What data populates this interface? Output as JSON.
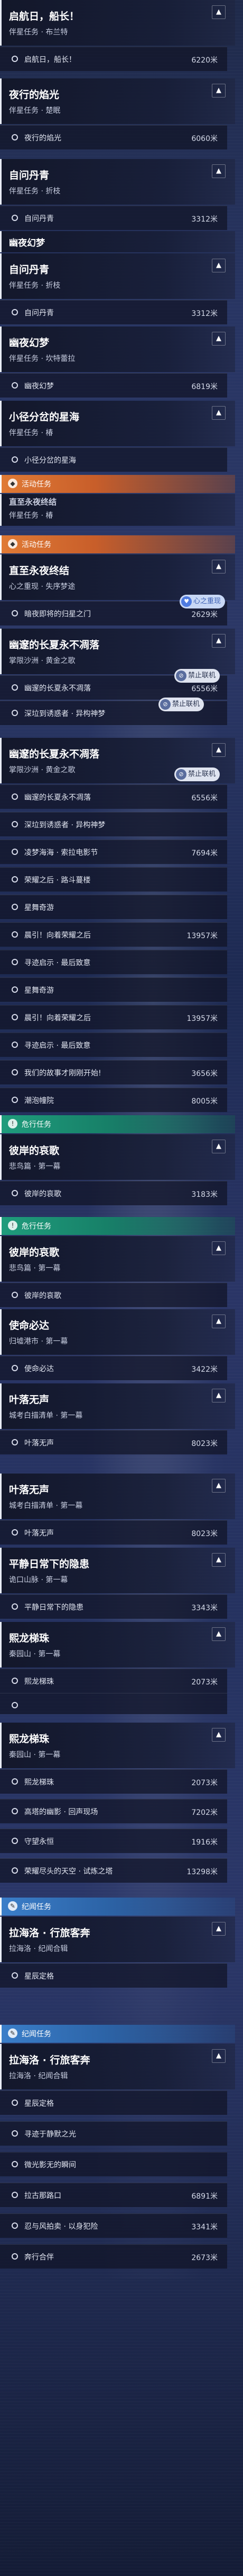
{
  "labels": {
    "activity": "活动任务",
    "dangerous": "危行任务",
    "record": "纪闻任务",
    "disconnect": "禁止联机",
    "heart": "心之重现"
  },
  "quests": {
    "q1": {
      "title": "启航日，船长！",
      "sub": "伴星任务 · 布兰特",
      "obj": "启航日，船长！",
      "dist": "6220米"
    },
    "q2": {
      "title": "夜行的焰光",
      "sub": "伴星任务 · 楚眠",
      "obj": "夜行的焰光",
      "dist": "6060米"
    },
    "q3": {
      "title": "自问丹青",
      "sub": "伴星任务 · 折枝",
      "obj": "自问丹青",
      "dist": "3312米"
    },
    "q4": {
      "title": "幽夜幻梦",
      "sub": "伴星任务 · 坎特蕾拉",
      "obj": "幽夜幻梦",
      "dist": "6819米"
    },
    "q5": {
      "title": "小径分岔的星海",
      "sub": "伴星任务 · 椿",
      "obj": "小径分岔的星海"
    },
    "q6": {
      "title": "直至永夜终结",
      "sub": "心之重现 · 失序梦途",
      "obj": "暗夜即将的归星之门",
      "dist": "2629米"
    },
    "q7": {
      "title": "幽邃的长夏永不凋落",
      "sub": "掌限沙洲 · 黄金之歌",
      "obj": "幽邃的长夏永不凋落",
      "dist": "6556米",
      "obj2": "深垃到诱惑者 · 异构神梦"
    },
    "q8": {
      "rows": [
        {
          "t": "幽邃的长夏永不凋落",
          "d": "6556米"
        },
        {
          "t": "深垃到诱惑者 · 异构神梦",
          "d": ""
        },
        {
          "t": "凌梦海海 · 索拉电影节",
          "d": "7694米"
        },
        {
          "t": "荣耀之后 · 路斗蔓楼",
          "d": ""
        },
        {
          "t": "星舞奇游",
          "d": ""
        },
        {
          "t": "晨引！向着荣耀之后",
          "d": "13957米"
        },
        {
          "t": "寻迹启示 · 最后致意",
          "d": ""
        },
        {
          "t": "星舞奇游",
          "d": ""
        },
        {
          "t": "晨引！向着荣耀之后",
          "d": "13957米"
        },
        {
          "t": "寻迹启示 · 最后致意",
          "d": ""
        },
        {
          "t": "我们的故事才刚刚开始!",
          "d": "3656米"
        },
        {
          "t": "潮泡幢院",
          "d": "8005米"
        }
      ]
    },
    "q9": {
      "title": "彼岸的哀歌",
      "sub": "悲鸟篇 · 第一幕",
      "obj": "彼岸的哀歌",
      "dist": "3183米"
    },
    "q10": {
      "title": "使命必达",
      "sub": "归墟港市 · 第一幕",
      "obj": "使命必达",
      "dist": "3422米"
    },
    "q11": {
      "title": "叶落无声",
      "sub": "城考白描清单 · 第一幕",
      "obj": "叶落无声",
      "dist": "8023米"
    },
    "q12": {
      "title": "平静日常下的隐患",
      "sub": "诡口山脉 · 第一幕",
      "obj": "平静日常下的隐患",
      "dist": "3343米"
    },
    "q13": {
      "title": "熙龙梯珠",
      "sub": "秦园山 · 第一幕",
      "obj": "熙龙梯珠",
      "dist": "2073米"
    },
    "q14": {
      "rows": [
        {
          "t": "熙龙梯珠",
          "d": "2073米"
        },
        {
          "t": "高塔的幽影 · 回声现场",
          "d": "7202米"
        },
        {
          "t": "守望永恒",
          "d": "1916米"
        },
        {
          "t": "荣耀尽头的天空 · 试炼之塔",
          "d": "13298米"
        }
      ]
    },
    "q15": {
      "title": "拉海洛 · 行旅客奔",
      "sub": "拉海洛 · 纪闻合辑",
      "obj": "星辰定格",
      "dist": ""
    },
    "q16": {
      "rows": [
        {
          "t": "星辰定格",
          "d": ""
        },
        {
          "t": "寻迹于静默之光",
          "d": ""
        },
        {
          "t": "微光影无的瞬间",
          "d": ""
        },
        {
          "t": "拉古那路口",
          "d": "6891米"
        },
        {
          "t": "忍与风拍卖 · 以身犯险",
          "d": "3341米"
        },
        {
          "t": "奔行合伴",
          "d": "2673米"
        }
      ]
    }
  },
  "misc": {
    "partner_prev": "伴星任务 · 椿",
    "q6_dup": "直至永夜终结"
  }
}
